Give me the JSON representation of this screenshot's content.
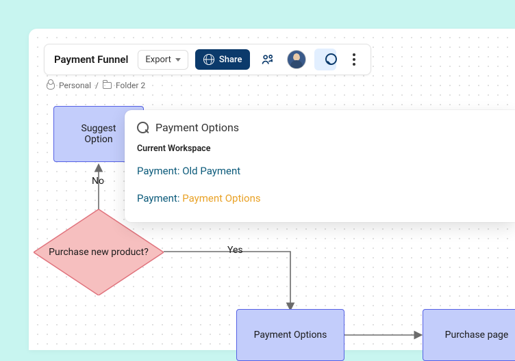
{
  "title": "Payment Funnel",
  "toolbar": {
    "export_label": "Export",
    "share_label": "Share"
  },
  "breadcrumb": {
    "scope": "Personal",
    "folder": "Folder 2"
  },
  "nodes": {
    "suggest": "Suggest\nOption",
    "decision": "Purchase new\nproduct?",
    "payment_options": "Payment Options",
    "purchase_page": "Purchase page"
  },
  "edges": {
    "no": "No",
    "yes": "Yes"
  },
  "search": {
    "query": "Payment Options",
    "section": "Current Workspace",
    "results": [
      {
        "prefix": "Payment: ",
        "plain": "Old Payment",
        "match": ""
      },
      {
        "prefix": "Payment: ",
        "plain": "",
        "match": "Payment Options"
      }
    ]
  }
}
